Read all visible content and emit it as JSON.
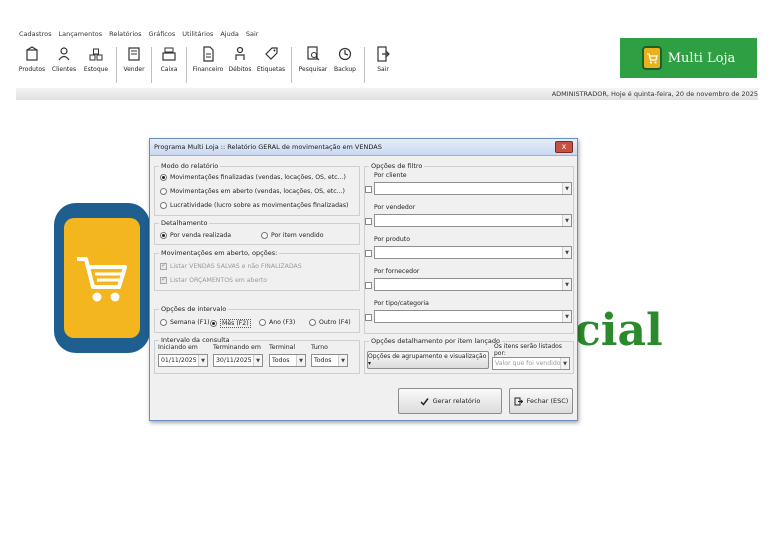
{
  "menu": [
    "Cadastros",
    "Lançamentos",
    "Relatórios",
    "Gráficos",
    "Utilitários",
    "Ajuda",
    "Sair"
  ],
  "toolbar": {
    "produtos": "Produtos",
    "clientes": "Clientes",
    "estoque": "Estoque",
    "vender": "Vender",
    "caixa": "Caixa",
    "financeiro": "Financeiro",
    "debitos": "Débitos",
    "etiquetas": "Etiquetas",
    "pesquisar": "Pesquisar",
    "backup": "Backup",
    "sair": "Sair"
  },
  "brand": {
    "name": "Multi Loja",
    "color": "#2ea043"
  },
  "status_line": "ADMINISTRADOR, Hoje é quinta-feira, 20 de novembro de 2025",
  "background_word": "cial",
  "dialog": {
    "title": "Programa Multi Loja :: Relatório GERAL de movimentação em VENDAS",
    "close": "x",
    "modo": {
      "legend": "Modo do relatório",
      "options": [
        "Movimentações finalizadas (vendas, locações, OS, etc...)",
        "Movimentações em aberto (vendas, locações, OS, etc...)",
        "Lucratividade (lucro sobre as movimentações finalizadas)"
      ],
      "selected": 0
    },
    "detalhamento": {
      "legend": "Detalhamento",
      "options": [
        "Por venda realizada",
        "Por item vendido"
      ],
      "selected": 0
    },
    "aberto": {
      "legend": "Movimentações em aberto, opções:",
      "options": [
        "Listar VENDAS SALVAS e não FINALIZADAS",
        "Listar ORÇAMENTOS em aberto"
      ]
    },
    "intervalo_opcoes": {
      "legend": "Opções de intervalo",
      "options": [
        "Semana (F1)",
        "Mês (F2)",
        "Ano (F3)",
        "Outro (F4)"
      ],
      "selected": 1
    },
    "consulta": {
      "legend": "Intervalo da consulta",
      "iniciando_label": "Iniciando em",
      "iniciando_value": "01/11/2025",
      "terminando_label": "Terminando em",
      "terminando_value": "30/11/2025",
      "terminal_label": "Terminal",
      "terminal_value": "Todos",
      "turno_label": "Turno",
      "turno_value": "Todos"
    },
    "filtro": {
      "legend": "Opções de filtro",
      "labels": [
        "Por cliente",
        "Por vendedor",
        "Por produto",
        "Por fornecedor",
        "Por tipo/categoria"
      ]
    },
    "detalhe_item": {
      "legend": "Opções detalhamento por item lançado",
      "button": "Opções de agrupamento e visualização ▾"
    },
    "listados": {
      "legend": "Os itens serão listados por:",
      "value": "Valor que foi vendido"
    },
    "gerar": "Gerar relatório",
    "fechar": "Fechar (ESC)"
  }
}
